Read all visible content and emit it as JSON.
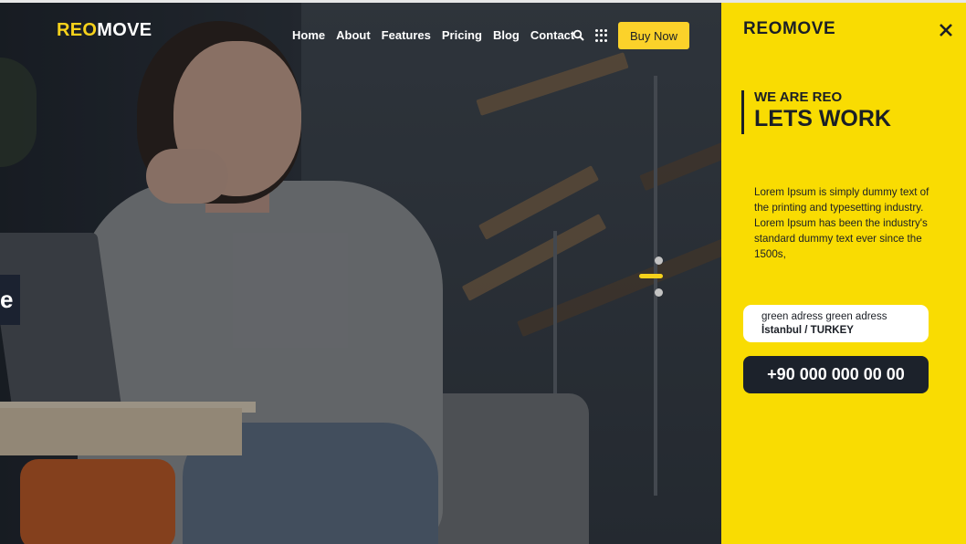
{
  "header": {
    "logo_part1": "REO",
    "logo_part2": "MOVE",
    "nav": [
      "Home",
      "About",
      "Features",
      "Pricing",
      "Blog",
      "Contact"
    ],
    "buy_label": "Buy Now",
    "icons": [
      "search-icon",
      "grid-menu-icon"
    ]
  },
  "hero": {
    "slide_text_fragment": "e",
    "slider_dots": 3,
    "active_slide": 2
  },
  "side_panel": {
    "logo": "REOMOVE",
    "close_icon": "close-icon",
    "subtitle": "WE ARE REO",
    "title": "LETS WORK",
    "description": "Lorem Ipsum is simply dummy text of the printing and typesetting industry. Lorem Ipsum has been the industry's standard dummy text ever since the 1500s,",
    "address_line1": "green adress green adress",
    "address_line2": "İstanbul / TURKEY",
    "phone": "+90 000 000 00 00"
  },
  "colors": {
    "accent": "#f9dc02",
    "button_yellow": "#fbd22a",
    "dark": "#1c222b"
  }
}
